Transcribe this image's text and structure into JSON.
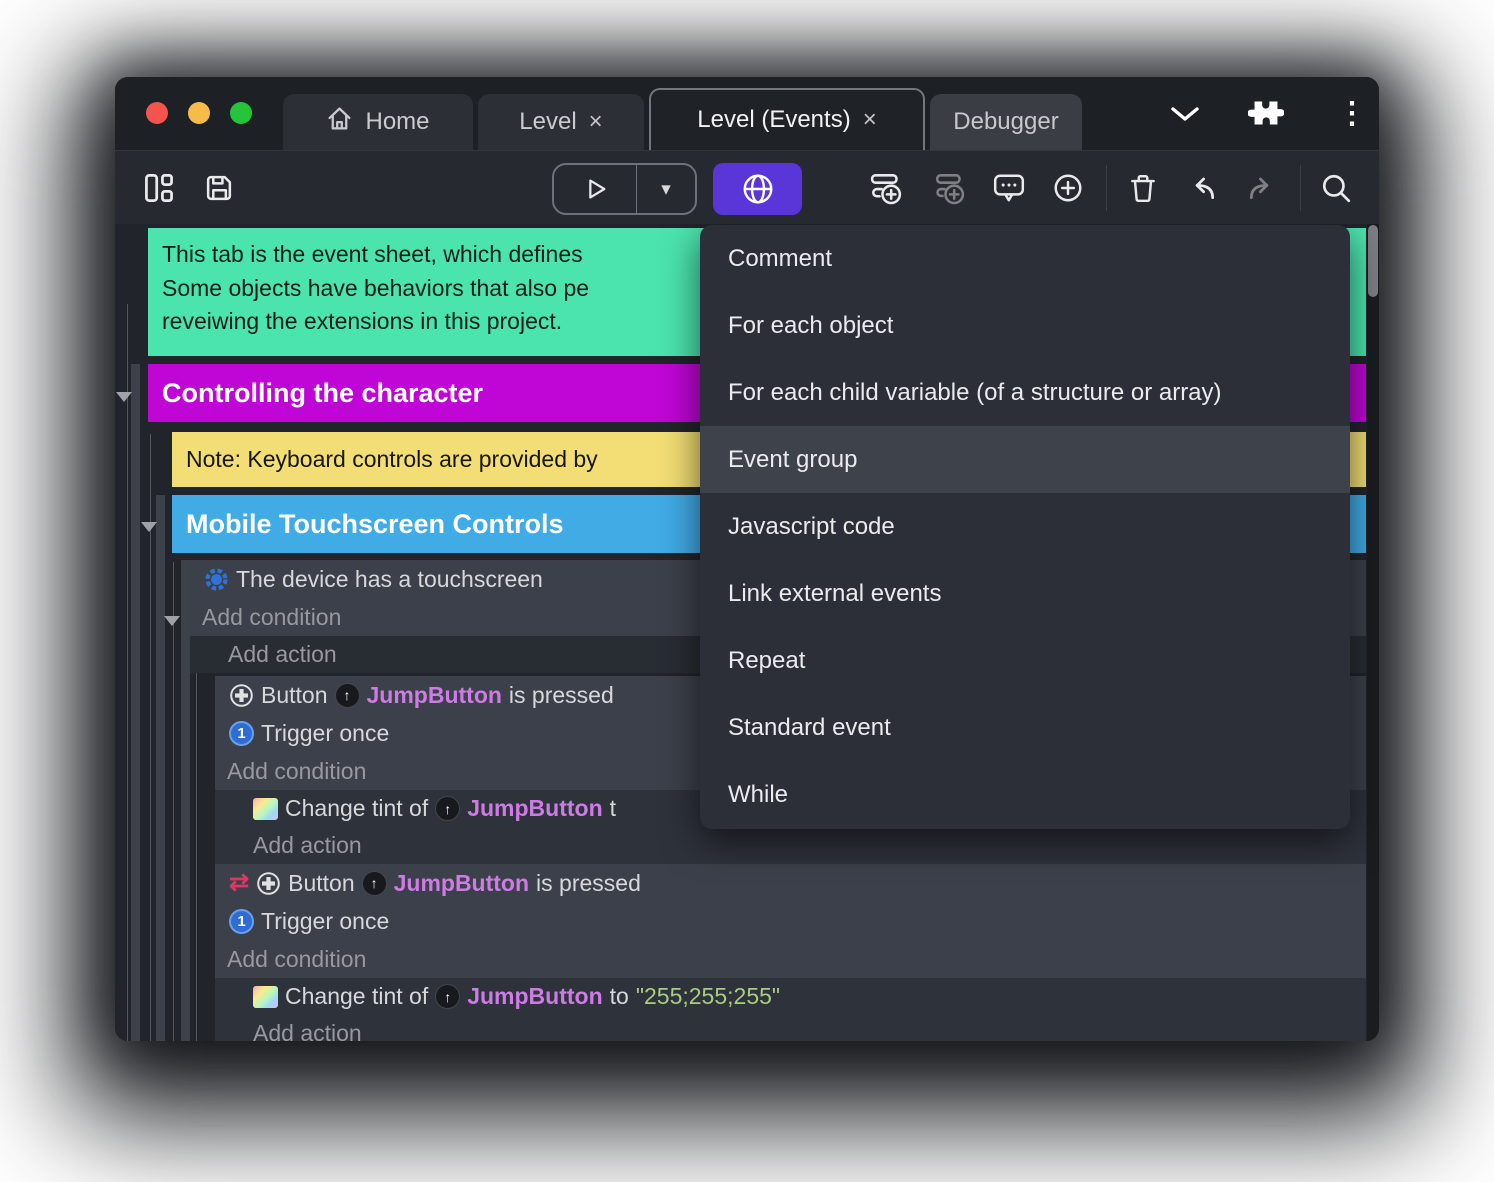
{
  "colors": {
    "window_bg": "#1d2025",
    "toolbar_bg": "#26292f",
    "sheet_bg": "#21242a",
    "menu_bg": "#2c2f37",
    "menu_highlight": "#3e424b",
    "accent_purple_button": "#5a35d8",
    "comment_teal": "#4be4ae",
    "group_magenta": "#bf06d6",
    "note_yellow": "#f2de74",
    "group_blue": "#41abe6",
    "object_name_violet": "#cd7ce4",
    "string_green": "#a8cc80",
    "traffic_red": "#f4544d",
    "traffic_yellow": "#f5bd47",
    "traffic_green": "#25c53b"
  },
  "glyphs": {
    "close": "×",
    "kebab": "⋮",
    "caret": "▾",
    "up_arrow": "↑",
    "one": "1",
    "invert": "⇄"
  },
  "titlebar": {
    "tabs": [
      {
        "label": "Home"
      },
      {
        "label": "Level"
      },
      {
        "label": "Level (Events)"
      },
      {
        "label": "Debugger"
      }
    ]
  },
  "menu": {
    "highlighted_item": "Event group",
    "items": [
      "Comment",
      "For each object",
      "For each child variable (of a structure or array)",
      "Event group",
      "Javascript code",
      "Link external events",
      "Repeat",
      "Standard event",
      "While"
    ]
  },
  "sheet": {
    "comment_lines": [
      "This tab is the event sheet, which defines",
      "Some objects have behaviors that also pe",
      "reveiwing the extensions in this project."
    ],
    "group_controlling": "Controlling the character",
    "note": "Note: Keyboard controls are provided by",
    "group_mobile": "Mobile Touchscreen Controls",
    "labels": {
      "add_condition": "Add condition",
      "add_action": "Add action"
    },
    "event_touch": {
      "condition": "The device has a touchscreen"
    },
    "event_jump1": {
      "object": "Button",
      "instance": "JumpButton",
      "suffix": " is pressed",
      "trigger": "Trigger once",
      "tint_prefix": "Change tint of ",
      "tint_tail": " t"
    },
    "event_jump2": {
      "object": "Button",
      "instance": "JumpButton",
      "suffix": " is pressed",
      "trigger": "Trigger once",
      "tint_prefix": "Change tint of ",
      "to": " to ",
      "value": "\"255;255;255\""
    }
  }
}
